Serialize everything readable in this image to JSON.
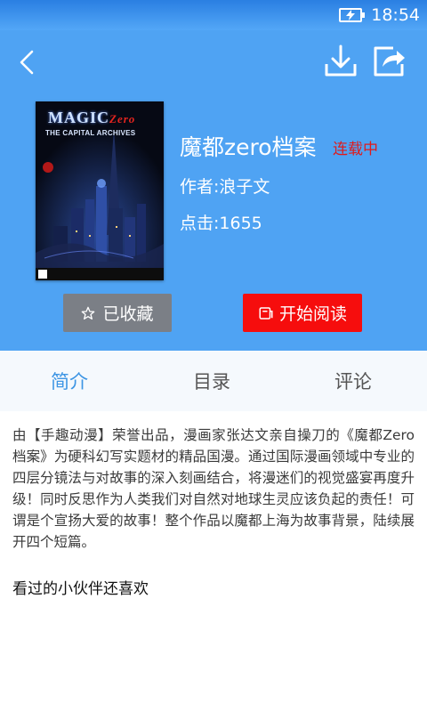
{
  "status_bar": {
    "time": "18:54"
  },
  "icons": {
    "back": "chevron-left-icon",
    "download": "download-icon",
    "share": "share-icon",
    "favorite": "star-icon",
    "read": "book-icon"
  },
  "book": {
    "title": "魔都zero档案",
    "status": "连载中",
    "author": "作者:浪子文",
    "clicks": "点击:1655",
    "cover": {
      "title_main": "MAGIC",
      "title_accent": "Zero",
      "subtitle": "THE CAPITAL ARCHIVES"
    }
  },
  "actions": {
    "favorite_label": "已收藏",
    "read_label": "开始阅读"
  },
  "tabs": [
    {
      "label": "简介",
      "active": true
    },
    {
      "label": "目录",
      "active": false
    },
    {
      "label": "评论",
      "active": false
    }
  ],
  "intro_text": "由【手趣动漫】荣誉出品，漫画家张达文亲自操刀的《魔都Zero档案》为硬科幻写实题材的精品国漫。通过国际漫画领域中专业的四层分镜法与对故事的深入刻画结合，将漫迷们的视觉盛宴再度升级！同时反思作为人类我们对自然对地球生灵应该负起的责任！可谓是个宣扬大爱的故事！整个作品以魔都上海为故事背景，陆续展开四个短篇。",
  "section": {
    "also_like": "看过的小伙伴还喜欢"
  },
  "colors": {
    "header_bg": "#4fa3f3",
    "status_red": "#e01a1a",
    "read_button": "#f60d0d",
    "favorite_button": "#7b7f86",
    "active_tab": "#3d95e4"
  }
}
